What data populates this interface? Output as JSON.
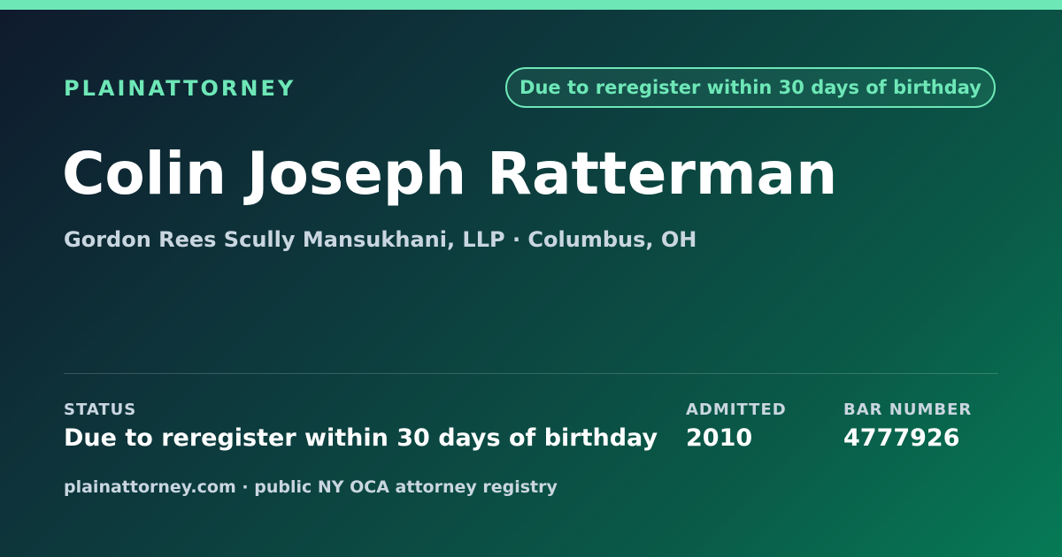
{
  "header": {
    "brand": "PLAINATTORNEY",
    "status_pill": "Due to reregister within 30 days of birthday"
  },
  "attorney": {
    "name": "Colin Joseph Ratterman",
    "firm_location": "Gordon Rees Scully Mansukhani, LLP · Columbus, OH"
  },
  "fields": {
    "status_label": "STATUS",
    "status_value": "Due to reregister within 30 days of birthday",
    "admitted_label": "ADMITTED",
    "admitted_value": "2010",
    "bar_label": "BAR NUMBER",
    "bar_value": "4777926"
  },
  "footer": {
    "text": "plainattorney.com · public NY OCA attorney registry"
  },
  "colors": {
    "accent": "#6ee7b7",
    "gradient_start": "#0f1a2c",
    "gradient_end": "#067a55"
  }
}
